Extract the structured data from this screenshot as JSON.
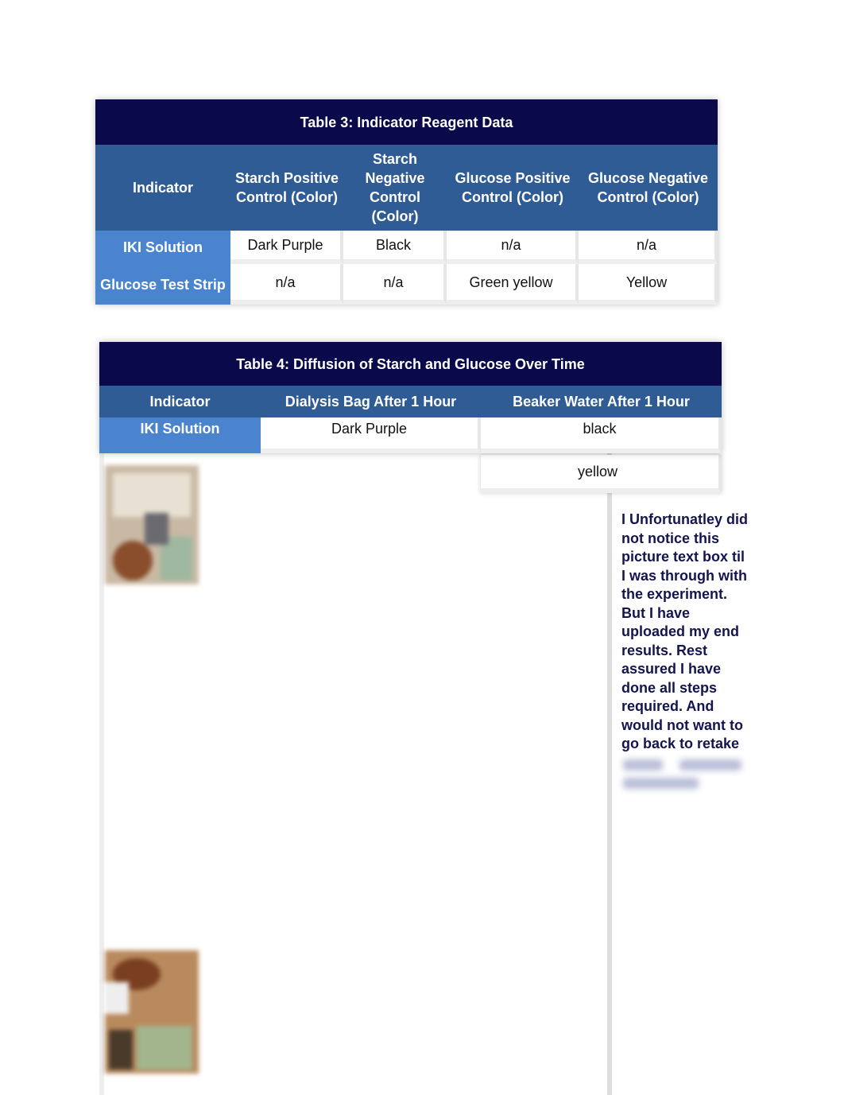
{
  "table3": {
    "title": "Table 3: Indicator Reagent Data",
    "headers": [
      "Indicator",
      "Starch Positive Control (Color)",
      "Starch Negative Control (Color)",
      "Glucose Positive Control (Color)",
      "Glucose Negative Control (Color)"
    ],
    "rows": [
      [
        "IKI Solution",
        "Dark Purple",
        "Black",
        "n/a",
        "n/a"
      ],
      [
        "Glucose Test Strip",
        "n/a",
        "n/a",
        "Green yellow",
        "Yellow"
      ]
    ]
  },
  "table4": {
    "title": "Table 4: Diffusion of Starch and Glucose Over Time",
    "headers": [
      "Indicator",
      "Dialysis Bag After 1 Hour",
      "Beaker Water After 1 Hour"
    ],
    "rows": [
      [
        "IKI Solution",
        "Dark Purple",
        "black"
      ]
    ],
    "extra_value": "yellow"
  },
  "note": "I Unfortunatley did not notice this picture text box til I was through with the experiment. But I have uploaded my end results. Rest assured I have done all steps required. And would not want to go back to retake",
  "colors": {
    "title_bg": "#0a0a4a",
    "header_bg": "#2f5c95",
    "row_header_bg": "#4a84cf",
    "note_text": "#141450"
  }
}
